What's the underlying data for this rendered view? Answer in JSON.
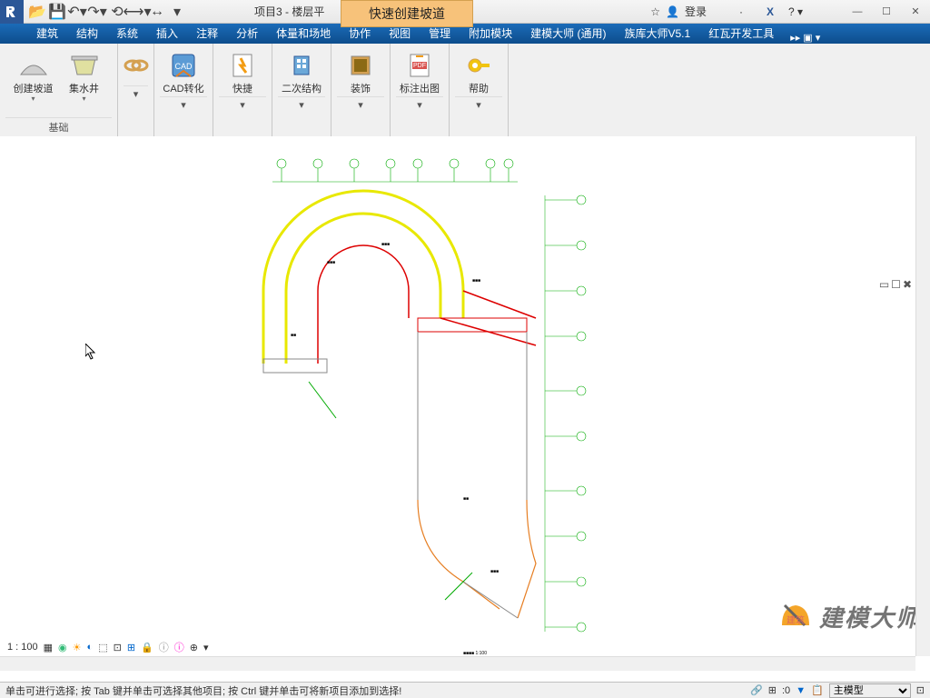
{
  "title": "项目3 - 楼层平",
  "tooltip": "快速创建坡道",
  "login": "登录",
  "tabs": [
    "建筑",
    "结构",
    "系统",
    "插入",
    "注释",
    "分析",
    "体量和场地",
    "协作",
    "视图",
    "管理",
    "附加模块",
    "建模大师 (通用)",
    "族库大师V5.1",
    "红瓦开发工具"
  ],
  "ribbon": {
    "groups": [
      {
        "label": "基础",
        "buttons": [
          {
            "label": "创建坡道"
          },
          {
            "label": "集水井"
          }
        ]
      },
      {
        "label": "",
        "buttons": [
          {
            "label": ""
          }
        ]
      },
      {
        "label": "",
        "buttons": [
          {
            "label": "CAD转化"
          }
        ]
      },
      {
        "label": "",
        "buttons": [
          {
            "label": "快捷"
          }
        ]
      },
      {
        "label": "",
        "buttons": [
          {
            "label": "二次结构"
          }
        ]
      },
      {
        "label": "",
        "buttons": [
          {
            "label": "装饰"
          }
        ]
      },
      {
        "label": "",
        "buttons": [
          {
            "label": "标注出图"
          }
        ]
      },
      {
        "label": "",
        "buttons": [
          {
            "label": "帮助"
          }
        ]
      }
    ]
  },
  "scale": "1 : 100",
  "status": "单击可进行选择; 按 Tab 键并单击可选择其他项目; 按 Ctrl 键并单击可将新项目添加到选择!",
  "status_count": ":0",
  "workset": "主模型",
  "logo": "建模大师"
}
